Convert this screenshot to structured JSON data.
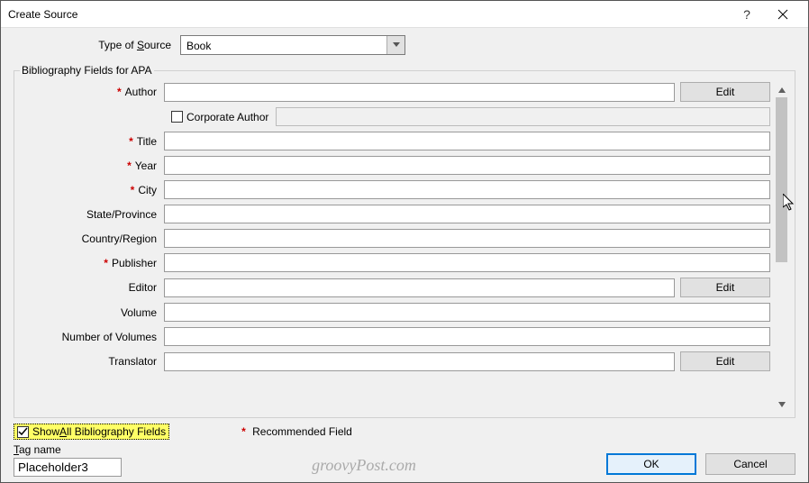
{
  "window": {
    "title": "Create Source"
  },
  "source": {
    "type_label_pre": "Type of ",
    "type_label_ul": "S",
    "type_label_post": "ource",
    "type_value": "Book"
  },
  "fieldset": {
    "legend": "Bibliography Fields for APA"
  },
  "fields": [
    {
      "key": "author",
      "label": "Author",
      "required": true,
      "edit": true,
      "value": ""
    },
    {
      "key": "title",
      "label": "Title",
      "required": true,
      "edit": false,
      "value": ""
    },
    {
      "key": "year",
      "label": "Year",
      "required": true,
      "edit": false,
      "value": ""
    },
    {
      "key": "city",
      "label": "City",
      "required": true,
      "edit": false,
      "value": ""
    },
    {
      "key": "state",
      "label": "State/Province",
      "required": false,
      "edit": false,
      "value": ""
    },
    {
      "key": "country",
      "label": "Country/Region",
      "required": false,
      "edit": false,
      "value": ""
    },
    {
      "key": "publisher",
      "label": "Publisher",
      "required": true,
      "edit": false,
      "value": ""
    },
    {
      "key": "editor",
      "label": "Editor",
      "required": false,
      "edit": true,
      "value": ""
    },
    {
      "key": "volume",
      "label": "Volume",
      "required": false,
      "edit": false,
      "value": ""
    },
    {
      "key": "numvol",
      "label": "Number of Volumes",
      "required": false,
      "edit": false,
      "value": ""
    },
    {
      "key": "translator",
      "label": "Translator",
      "required": false,
      "edit": true,
      "value": ""
    }
  ],
  "corporate": {
    "label": "Corporate Author",
    "checked": false
  },
  "edit_label": "Edit",
  "footer": {
    "show_all_pre": "Show ",
    "show_all_ul": "A",
    "show_all_post": "ll Bibliography Fields",
    "show_all_checked": true,
    "recommended": "Recommended Field",
    "tag_label_ul": "T",
    "tag_label_post": "ag name",
    "tag_value": "Placeholder3",
    "watermark": "groovyPost.com",
    "ok": "OK",
    "cancel": "Cancel"
  }
}
